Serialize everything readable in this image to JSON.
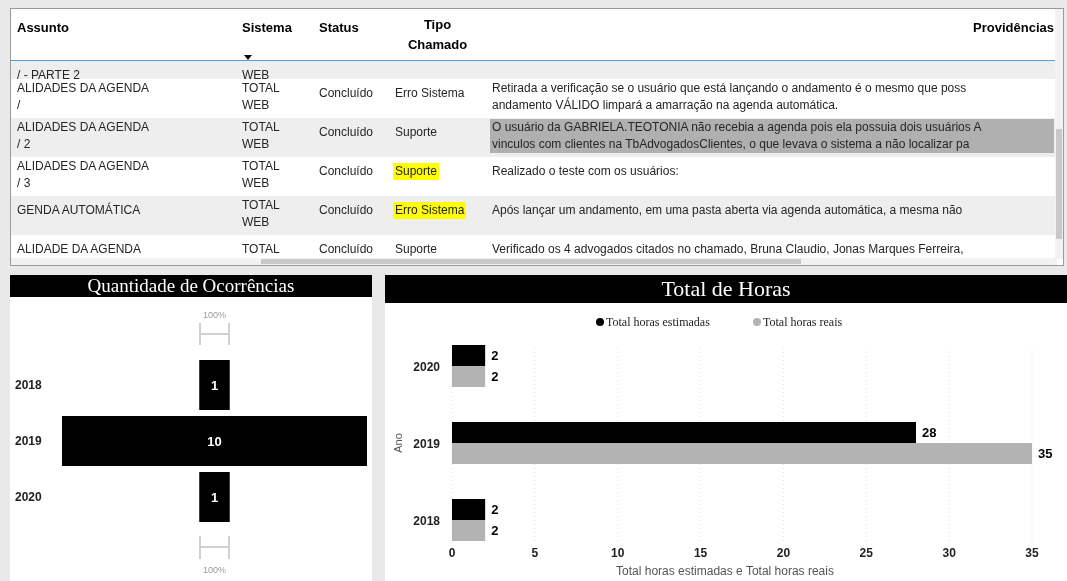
{
  "table": {
    "columns": [
      {
        "label": "Assunto",
        "sorted": false
      },
      {
        "label": "Sistema",
        "sorted": true
      },
      {
        "label": "Status",
        "sorted": false
      },
      {
        "label": "Tipo\nChamado",
        "sorted": false
      },
      {
        "label": "Providências",
        "sorted": false
      }
    ],
    "rows": [
      {
        "partial": true,
        "cells": [
          {
            "text": "/ - PARTE 2",
            "selected": false,
            "highlighted": false
          },
          {
            "text": "WEB",
            "selected": false,
            "highlighted": false
          }
        ]
      },
      {
        "partial": false,
        "cells": [
          {
            "text": "ALIDADES DA AGENDA\n/",
            "selected": false,
            "highlighted": false
          },
          {
            "text": "TOTAL\nWEB",
            "selected": false,
            "highlighted": false
          },
          {
            "text": "Concluído",
            "selected": false,
            "highlighted": false
          },
          {
            "text": "Erro Sistema",
            "selected": false,
            "highlighted": false
          },
          {
            "text": "Retirada a verificação se o usuário que está lançando o andamento é o mesmo que poss\nandamento VÁLIDO limpará a amarração na agenda automática.",
            "selected": false,
            "highlighted": false
          }
        ]
      },
      {
        "partial": false,
        "cells": [
          {
            "text": "ALIDADES DA AGENDA\n/ 2",
            "selected": false,
            "highlighted": false
          },
          {
            "text": "TOTAL\nWEB",
            "selected": false,
            "highlighted": false
          },
          {
            "text": "Concluído",
            "selected": false,
            "highlighted": false
          },
          {
            "text": "Suporte",
            "selected": false,
            "highlighted": false
          },
          {
            "text": "O usuário da GABRIELA.TEOTONIA não recebia a agenda pois ela possuia dois usuários A\nvinculos com clientes na TbAdvogadosClientes, o que levava o sistema a não localizar pa",
            "selected": true,
            "highlighted": false
          }
        ]
      },
      {
        "partial": false,
        "cells": [
          {
            "text": "ALIDADES DA AGENDA\n/ 3",
            "selected": false,
            "highlighted": false
          },
          {
            "text": "TOTAL\nWEB",
            "selected": false,
            "highlighted": false
          },
          {
            "text": "Concluído",
            "selected": false,
            "highlighted": false
          },
          {
            "text": "Suporte",
            "selected": false,
            "highlighted": true
          },
          {
            "text": "Realizado o teste com os usuários:",
            "selected": false,
            "highlighted": false
          }
        ]
      },
      {
        "partial": false,
        "cells": [
          {
            "text": "GENDA AUTOMÁTICA",
            "selected": false,
            "highlighted": false
          },
          {
            "text": "TOTAL\nWEB",
            "selected": false,
            "highlighted": false
          },
          {
            "text": "Concluído",
            "selected": false,
            "highlighted": false
          },
          {
            "text": "Erro Sistema",
            "selected": false,
            "highlighted": true
          },
          {
            "text": "Após lançar um andamento, em uma pasta aberta via agenda automática, a mesma não",
            "selected": false,
            "highlighted": false
          }
        ]
      },
      {
        "partial": true,
        "cells": [
          {
            "text": "ALIDADE DA AGENDA",
            "selected": false,
            "highlighted": false
          },
          {
            "text": "TOTAL",
            "selected": false,
            "highlighted": false
          },
          {
            "text": "Concluído",
            "selected": false,
            "highlighted": false
          },
          {
            "text": "Suporte",
            "selected": false,
            "highlighted": false
          },
          {
            "text": "Verificado os 4 advogados citados no chamado, Bruna Claudio, Jonas Marques Ferreira,",
            "selected": false,
            "highlighted": false
          }
        ]
      }
    ]
  },
  "occurrences": {
    "title": "Quantidade de Ocorrências",
    "top_label": "100%",
    "bottom_label": "100%",
    "stages": [
      {
        "label": "2018",
        "value": "1"
      },
      {
        "label": "2019",
        "value": "10"
      },
      {
        "label": "2020",
        "value": "1"
      }
    ]
  },
  "hours": {
    "title": "Total de Horas",
    "chart_data": {
      "type": "bar",
      "orientation": "horizontal",
      "categories": [
        "2020",
        "2019",
        "2018"
      ],
      "series": [
        {
          "name": "Total horas estimadas",
          "color": "#000000",
          "values": [
            2,
            28,
            2
          ]
        },
        {
          "name": "Total horas reais",
          "color": "#b3b3b3",
          "values": [
            2,
            35,
            2
          ]
        }
      ],
      "xlim": [
        0,
        35
      ],
      "xticks": [
        0,
        5,
        10,
        15,
        20,
        25,
        30,
        35
      ],
      "xlabel": "Total horas estimadas e Total horas reais",
      "ylabel": "Ano",
      "data_labels": true,
      "grid": true,
      "legend": true
    }
  }
}
